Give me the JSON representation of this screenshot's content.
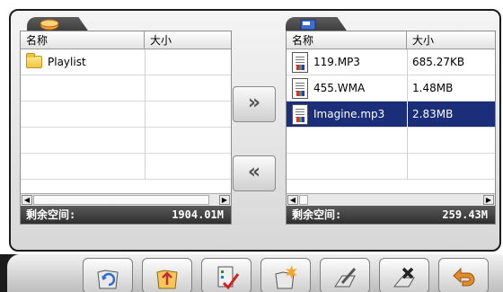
{
  "left_pane": {
    "col_name": "名称",
    "col_size": "大小",
    "rows": [
      {
        "name": "Playlist",
        "size": "",
        "type": "folder"
      }
    ],
    "status_label": "剩余空间:",
    "status_value": "1904.01M"
  },
  "right_pane": {
    "col_name": "名称",
    "col_size": "大小",
    "rows": [
      {
        "name": "119.MP3",
        "size": "685.27KB",
        "type": "audio"
      },
      {
        "name": "455.WMA",
        "size": "1.48MB",
        "type": "audio"
      },
      {
        "name": "Imagine.mp3",
        "size": "2.83MB",
        "type": "audio",
        "selected": true
      }
    ],
    "status_label": "剩余空间:",
    "status_value": "259.43M"
  },
  "transfer": {
    "to_right": "»",
    "to_left": "«"
  },
  "toolbar_icons": [
    "refresh-folder-icon",
    "folder-up-icon",
    "check-list-icon",
    "new-folder-icon",
    "rename-icon",
    "delete-icon",
    "back-icon"
  ],
  "colors": {
    "selection": "#1a2e7a",
    "status_bar": "#3a3a3a",
    "back_arrow": "#e08a2a"
  }
}
